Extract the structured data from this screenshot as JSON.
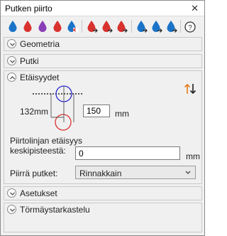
{
  "window": {
    "title": "Putken piirto",
    "close_glyph": "✕"
  },
  "toolbar": {
    "icons": [
      "blue-drop-icon",
      "red-drop-icon",
      "purple-drop-icon",
      "red-drop-icon",
      "blue-drop-text-icon",
      "red-drop-arrow-icon",
      "red-drop-arrow-icon",
      "red-drop-arrow-icon",
      "blue-drop-arrow-icon",
      "blue-drop-arrow-icon",
      "blue-drop-arrow-icon",
      "help-icon"
    ],
    "help_glyph": "?"
  },
  "colors": {
    "blue": "#1a73c8",
    "red": "#d8322f",
    "purple": "#8a3fb7",
    "orange": "#e57a1f",
    "dark": "#1e1e1e"
  },
  "sections": {
    "geometria": "Geometria",
    "putki": "Putki",
    "etaisyydet": "Etäisyydet",
    "asetukset": "Asetukset",
    "tormays": "Törmäystarkastelu"
  },
  "etaisyydet": {
    "dimension_label": "132mm",
    "distance_value": "150",
    "distance_unit": "mm",
    "offset_label": "Piirtolinjan etäisyys keskipisteestä:",
    "offset_value": "0",
    "offset_unit": "mm",
    "draw_label": "Piirrä putket:",
    "draw_value": "Rinnakkain"
  }
}
